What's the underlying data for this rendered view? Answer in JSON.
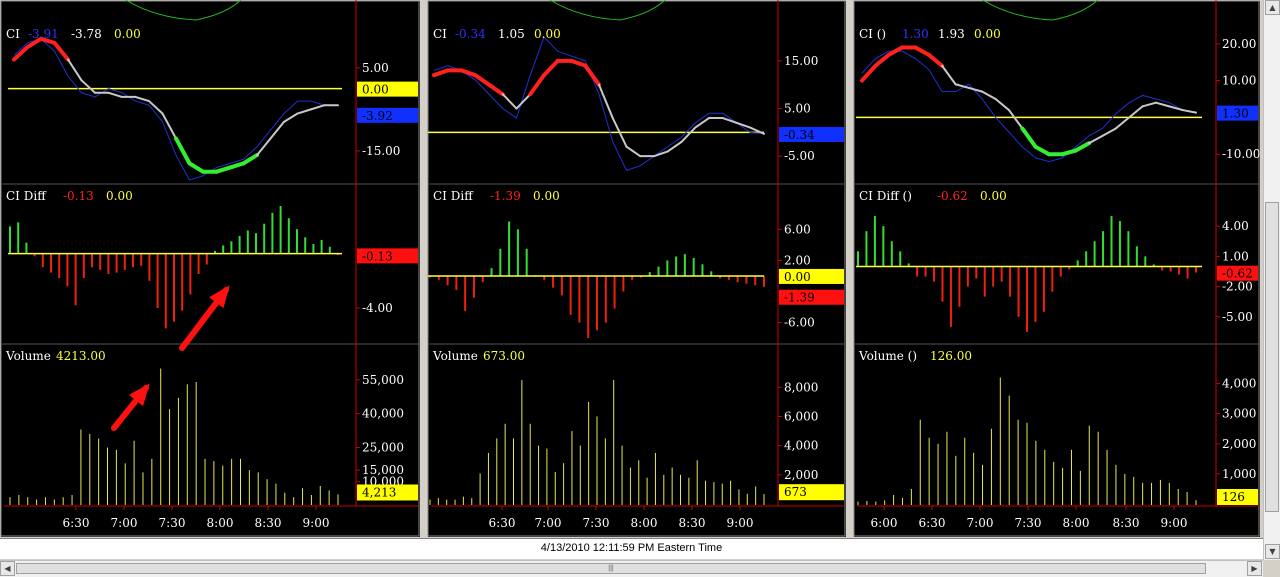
{
  "colors": {
    "bg": "#000000",
    "border": "#888888",
    "axis": "#cc0000",
    "grid": "#3a3a3a",
    "ci": "#c8c8c8",
    "ci_bull": "#ff2020",
    "ci_bear": "#33ee33",
    "ci_raw": "#2030d0",
    "zero": "#ffff40",
    "pos_bar": "#33dd33",
    "neg_bar": "#ee2010",
    "vol": "#e8e850",
    "label_white": "#ffffff",
    "label_blue": "#3030ff",
    "label_red": "#ff2020",
    "label_yellow": "#ffff40",
    "arrow": "#ff1010"
  },
  "status": {
    "text": "4/13/2010 12:11:59 PM Eastern Time"
  },
  "scroll": {
    "left_icon": "arrow-left-icon",
    "right_icon": "arrow-right-icon",
    "up_icon": "arrow-up-icon",
    "down_icon": "arrow-down-icon",
    "grip": "|||"
  },
  "chart_data": [
    {
      "type": "line",
      "panel": "left",
      "x_ticks": [
        "6:30",
        "7:00",
        "7:30",
        "8:00",
        "8:30",
        "9:00"
      ],
      "ci": {
        "header": "CI",
        "readouts": [
          "-3.91",
          "-3.78",
          "0.00"
        ],
        "y_ticks": [
          "5.00",
          "-15.00"
        ],
        "ylim": [
          -22,
          17
        ],
        "series_values": [
          7,
          10,
          12,
          11,
          7,
          2,
          -1,
          -1,
          -2,
          -2,
          -3,
          -6,
          -12,
          -18,
          -20,
          -20,
          -19,
          -18,
          -16,
          -12,
          -8,
          -6,
          -5,
          -4,
          -4
        ],
        "raw_values": [
          8,
          11,
          12,
          9,
          3,
          -1,
          -2,
          0,
          -1,
          -3,
          -4,
          -8,
          -16,
          -22,
          -21,
          -19,
          -18,
          -17,
          -14,
          -10,
          -6,
          -3,
          -3,
          -4,
          -4
        ],
        "color_segments": [
          "bull",
          "bull",
          "bull",
          "bull",
          "neutral",
          "neutral",
          "neutral",
          "neutral",
          "neutral",
          "neutral",
          "neutral",
          "neutral",
          "bear",
          "bear",
          "bear",
          "bear",
          "bear",
          "bear",
          "neutral",
          "neutral",
          "neutral",
          "neutral",
          "neutral",
          "neutral",
          "neutral"
        ],
        "zero": 0,
        "tags": [
          {
            "text": "0.00",
            "kind": "yellow",
            "value": 0
          },
          {
            "text": "-3.92",
            "kind": "blue",
            "value": -3.9
          }
        ]
      },
      "diff": {
        "header": "CI Diff",
        "readouts": [
          "-0.13",
          "0.00"
        ],
        "y_ticks": [
          "-4.00"
        ],
        "ylim": [
          -6.5,
          3.5
        ],
        "values": [
          2.0,
          2.3,
          0.8,
          -0.2,
          -1.0,
          -1.4,
          -1.8,
          -2.4,
          -3.8,
          -1.8,
          -1.0,
          -1.2,
          -1.5,
          -1.4,
          -1.2,
          -1.0,
          -0.9,
          -2.0,
          -4.0,
          -5.5,
          -5.0,
          -4.2,
          -3.0,
          -1.5,
          -0.8,
          0.2,
          0.6,
          0.9,
          1.3,
          1.7,
          1.5,
          2.2,
          3.0,
          3.5,
          2.6,
          1.8,
          1.2,
          0.7,
          1.0,
          0.5,
          -0.1
        ],
        "tags": [
          {
            "text": "-0.13",
            "kind": "red",
            "value": -0.13
          }
        ]
      },
      "volume": {
        "header": "Volume",
        "readouts": [
          "4213.00"
        ],
        "y_ticks": [
          "55,000",
          "40,000",
          "25,000",
          "15,000",
          "10,000"
        ],
        "ylim": [
          0,
          62000
        ],
        "values": [
          3000,
          4000,
          3000,
          2000,
          3000,
          2000,
          3000,
          4000,
          33000,
          31000,
          29000,
          25000,
          24000,
          18000,
          28000,
          14000,
          20000,
          60000,
          42000,
          47000,
          53000,
          54000,
          20000,
          19000,
          17000,
          20000,
          20000,
          15000,
          14000,
          11000,
          9000,
          5000,
          3000,
          7000,
          4000,
          8000,
          6000,
          4213
        ],
        "tags": [
          {
            "text": "4,213",
            "kind": "yellow",
            "value": 4213
          }
        ]
      },
      "annotations": [
        "red-arrow-up-to-ci-diff",
        "red-arrow-up-to-volume-spike"
      ]
    },
    {
      "type": "line",
      "panel": "middle",
      "x_ticks": [
        "6:30",
        "7:00",
        "7:30",
        "8:00",
        "8:30",
        "9:00"
      ],
      "ci": {
        "header": "CI",
        "readouts": [
          "-0.34",
          "1.05",
          "0.00"
        ],
        "y_ticks": [
          "15.00",
          "5.00",
          "-5.00"
        ],
        "ylim": [
          -10,
          24
        ],
        "series_values": [
          12,
          13,
          13,
          12,
          10,
          8,
          5,
          8,
          12,
          15,
          15,
          14,
          10,
          3,
          -3,
          -5,
          -5,
          -4,
          -2,
          1,
          3,
          3,
          2,
          1,
          -0.3
        ],
        "raw_values": [
          13,
          14,
          13,
          11,
          8,
          5,
          3,
          12,
          20,
          17,
          16,
          15,
          8,
          -2,
          -8,
          -7,
          -5,
          -3,
          -1,
          2,
          4,
          4,
          2,
          0,
          -0.3
        ],
        "color_segments": [
          "bull",
          "bull",
          "bull",
          "bull",
          "bull",
          "neutral",
          "neutral",
          "bull",
          "bull",
          "bull",
          "bull",
          "bull",
          "neutral",
          "neutral",
          "neutral",
          "neutral",
          "neutral",
          "neutral",
          "neutral",
          "neutral",
          "neutral",
          "neutral",
          "neutral",
          "neutral",
          "neutral"
        ],
        "zero": 0,
        "tags": [
          {
            "text": "-0.34",
            "kind": "blue",
            "value": -0.34
          }
        ]
      },
      "diff": {
        "header": "CI Diff",
        "readouts": [
          "-1.39",
          "0.00"
        ],
        "y_ticks": [
          "6.00",
          "2.00",
          "0.00",
          "-6.00"
        ],
        "ylim": [
          -8.5,
          9
        ],
        "values": [
          -0.2,
          -0.5,
          -1.2,
          -1.8,
          -4.5,
          -2.8,
          -0.8,
          1.0,
          3.5,
          7.0,
          6.0,
          3.5,
          0.1,
          -0.5,
          -1.5,
          -2.5,
          -5.0,
          -6.0,
          -8.0,
          -7.0,
          -6.0,
          -4.2,
          -2.0,
          -0.5,
          -0.2,
          0.5,
          1.2,
          2.0,
          2.5,
          2.8,
          2.3,
          1.5,
          0.6,
          -0.3,
          -0.5,
          -0.8,
          -1.0,
          -1.2,
          -1.4
        ],
        "tags": [
          {
            "text": "0.00",
            "kind": "yellow",
            "value": 0
          },
          {
            "text": "-1.39",
            "kind": "red",
            "value": -1.39
          }
        ]
      },
      "volume": {
        "header": "Volume",
        "readouts": [
          "673.00"
        ],
        "y_ticks": [
          "8,000",
          "6,000",
          "4,000",
          "2,000",
          "1,000"
        ],
        "ylim": [
          0,
          9600
        ],
        "values": [
          300,
          400,
          300,
          300,
          500,
          400,
          2100,
          3500,
          4500,
          5500,
          4500,
          8500,
          5500,
          4000,
          3800,
          2200,
          2800,
          5000,
          4000,
          7000,
          6000,
          4500,
          8500,
          4000,
          2500,
          3000,
          1800,
          3500,
          2000,
          2500,
          2000,
          1800,
          3000,
          1600,
          1500,
          1400,
          1600,
          1000,
          700,
          1200,
          673
        ],
        "tags": [
          {
            "text": "673",
            "kind": "yellow",
            "value": 673
          }
        ]
      }
    },
    {
      "type": "line",
      "panel": "right",
      "x_ticks": [
        "6:00",
        "6:30",
        "7:00",
        "7:30",
        "8:00",
        "8:30",
        "9:00"
      ],
      "ci": {
        "header": "CI ()",
        "readouts": [
          "1.30",
          "1.93",
          "0.00"
        ],
        "y_ticks": [
          "20.00",
          "10.00",
          "-10.00"
        ],
        "ylim": [
          -17,
          27
        ],
        "series_values": [
          10,
          14,
          17,
          19,
          19,
          17,
          14,
          9,
          8,
          7,
          5,
          2,
          -3,
          -8,
          -10,
          -10,
          -9,
          -7,
          -5,
          -3,
          0,
          3,
          4,
          3,
          2,
          1.3
        ],
        "raw_values": [
          12,
          16,
          18,
          18,
          16,
          13,
          7,
          7,
          9,
          5,
          0,
          -4,
          -8,
          -11,
          -12,
          -11,
          -8,
          -5,
          -3,
          1,
          4,
          6,
          5,
          4,
          2,
          1.3
        ],
        "color_segments": [
          "bull",
          "bull",
          "bull",
          "bull",
          "bull",
          "bull",
          "neutral",
          "neutral",
          "neutral",
          "neutral",
          "neutral",
          "neutral",
          "bear",
          "bear",
          "bear",
          "bear",
          "bear",
          "neutral",
          "neutral",
          "neutral",
          "neutral",
          "neutral",
          "neutral",
          "neutral",
          "neutral",
          "neutral"
        ],
        "zero": 0,
        "tags": [
          {
            "text": "1.30",
            "kind": "blue",
            "value": 1.3
          }
        ]
      },
      "diff": {
        "header": "CI Diff ()",
        "readouts": [
          "-0.62",
          "0.00"
        ],
        "y_ticks": [
          "4.00",
          "1.00",
          "-2.00",
          "-5.00"
        ],
        "ylim": [
          -7.5,
          6
        ],
        "values": [
          1.5,
          3.5,
          5.0,
          4.0,
          2.5,
          1.5,
          0.3,
          -1.0,
          -1.0,
          -1.5,
          -3.5,
          -6.0,
          -4.0,
          -2.0,
          -1.2,
          -3.0,
          -2.0,
          -1.5,
          -3.0,
          -5.0,
          -6.5,
          -5.5,
          -4.5,
          -2.5,
          -1.0,
          -0.3,
          0.6,
          1.5,
          2.5,
          3.5,
          5.0,
          4.5,
          3.5,
          2.0,
          1.0,
          0.2,
          -0.4,
          -0.5,
          -0.8,
          -1.2,
          -0.6
        ],
        "tags": [
          {
            "text": "-0.62",
            "kind": "red",
            "value": -0.62
          }
        ]
      },
      "volume": {
        "header": "Volume ()",
        "readouts": [
          "126.00"
        ],
        "y_ticks": [
          "4,000",
          "3,000",
          "2,000",
          "1,000"
        ],
        "ylim": [
          0,
          4650
        ],
        "values": [
          80,
          100,
          80,
          120,
          300,
          200,
          500,
          2800,
          2200,
          2000,
          2400,
          1600,
          2200,
          1700,
          1300,
          2500,
          4200,
          3600,
          2800,
          2700,
          2100,
          1800,
          1400,
          1200,
          1800,
          1100,
          2600,
          2400,
          1800,
          1300,
          1000,
          900,
          700,
          700,
          800,
          700,
          500,
          400,
          126
        ],
        "tags": [
          {
            "text": "126",
            "kind": "yellow",
            "value": 126
          }
        ]
      }
    }
  ]
}
